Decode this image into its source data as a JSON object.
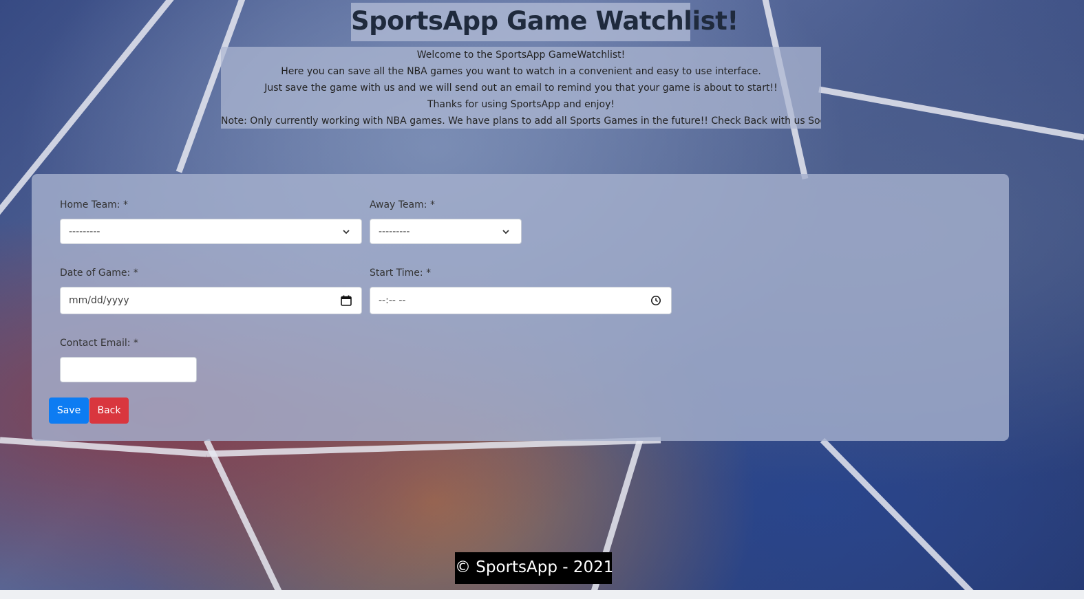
{
  "header": {
    "title": "SportsApp Game Watchlist!"
  },
  "intro": {
    "lines": [
      "Welcome to the SportsApp GameWatchlist!",
      "Here you can save all the NBA games you want to watch in a convenient and easy to use interface.",
      "Just save the game with us and we will send out an email to remind you that your game is about to start!!",
      "Thanks for using SportsApp and enjoy!",
      "Note: Only currently working with NBA games. We have plans to add all Sports Games in the future!! Check Back with us Soon!"
    ]
  },
  "form": {
    "home_team": {
      "label": "Home Team: *",
      "value": "---------"
    },
    "away_team": {
      "label": "Away Team: *",
      "value": "---------"
    },
    "date": {
      "label": "Date of Game: *",
      "placeholder": "mm/dd/yyyy"
    },
    "time": {
      "label": "Start Time: *",
      "placeholder": "--:-- --"
    },
    "email": {
      "label": "Contact Email: *",
      "value": ""
    },
    "save_label": "Save",
    "back_label": "Back"
  },
  "footer": {
    "text": "© SportsApp - 2021"
  },
  "colors": {
    "save": "#0d7cf2",
    "back": "#d9363e"
  },
  "icons": [
    "chevron-down-icon",
    "calendar-icon",
    "clock-icon"
  ]
}
